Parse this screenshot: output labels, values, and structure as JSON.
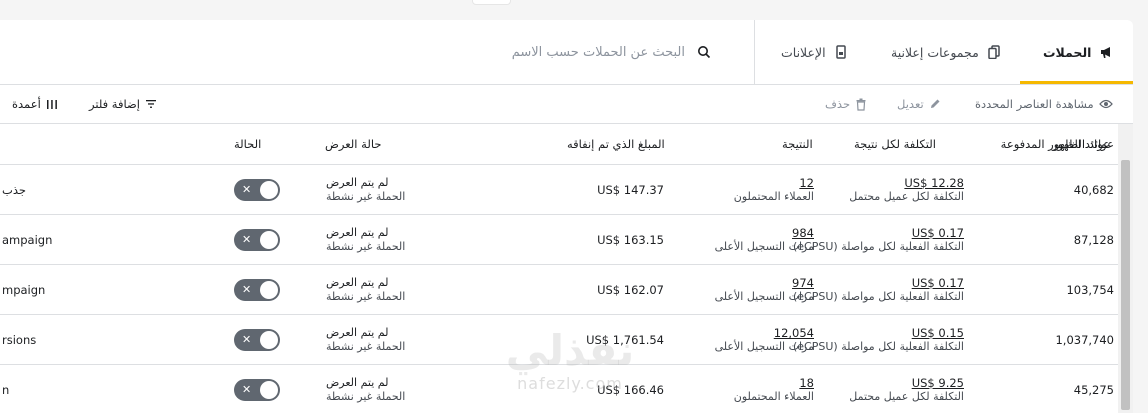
{
  "tabs": [
    {
      "label": "الحملات",
      "icon": "megaphone-icon",
      "active": true
    },
    {
      "label": "مجموعات إعلانية",
      "icon": "ad-sets-icon",
      "active": false
    },
    {
      "label": "الإعلانات",
      "icon": "ad-icon",
      "active": false
    }
  ],
  "search": {
    "placeholder": "البحث عن الحملات حسب الاسم"
  },
  "toolbar": {
    "view_selected": "مشاهدة العناصر المحددة",
    "edit": "تعديل",
    "delete": "حذف",
    "add_filter": "إضافة فلتر",
    "columns": "أعمدة"
  },
  "columns": {
    "name": "عوائد الظهور",
    "paid_reach": "عوائد الظهور المدفوعة",
    "cost_per_result": "التكلفة لكل نتيجة",
    "result": "النتيجة",
    "amount_spent": "المبلغ الذي تم إنفاقه",
    "delivery": "حالة العرض",
    "status": "الحالة"
  },
  "rows": [
    {
      "name": "جذب",
      "reach": "40,682",
      "cost": "US$ 12.28",
      "cost_label": "التكلفة لكل عميل محتمل",
      "result": "12",
      "result_label": "العملاء المحتملون",
      "spent": "US$ 147.37",
      "delivery": "لم يتم العرض",
      "delivery_sub": "الحملة غير نشطة"
    },
    {
      "name": "ampaign",
      "reach": "87,128",
      "cost": "US$ 0.17",
      "cost_label": "(eCPSU) التكلفة الفعلية لكل مواصلة",
      "result": "984",
      "result_label": "مرات التسجيل الأعلى",
      "spent": "US$ 163.15",
      "delivery": "لم يتم العرض",
      "delivery_sub": "الحملة غير نشطة"
    },
    {
      "name": "mpaign",
      "reach": "103,754",
      "cost": "US$ 0.17",
      "cost_label": "(eCPSU) التكلفة الفعلية لكل مواصلة",
      "result": "974",
      "result_label": "مرات التسجيل الأعلى",
      "spent": "US$ 162.07",
      "delivery": "لم يتم العرض",
      "delivery_sub": "الحملة غير نشطة"
    },
    {
      "name": "rsions",
      "reach": "1,037,740",
      "cost": "US$ 0.15",
      "cost_label": "(eCPSU) التكلفة الفعلية لكل مواصلة",
      "result": "12,054",
      "result_label": "مرات التسجيل الأعلى",
      "spent": "US$ 1,761.54",
      "delivery": "لم يتم العرض",
      "delivery_sub": "الحملة غير نشطة"
    },
    {
      "name": "n",
      "reach": "45,275",
      "cost": "US$ 9.25",
      "cost_label": "التكلفة لكل عميل محتمل",
      "result": "18",
      "result_label": "العملاء المحتملون",
      "spent": "US$ 166.46",
      "delivery": "لم يتم العرض",
      "delivery_sub": "الحملة غير نشطة"
    }
  ],
  "watermark": {
    "arabic": "نفذلي",
    "latin": "nafezly.com"
  },
  "colors": {
    "accent": "#f5b800",
    "toggle_off": "#606770",
    "border": "#dddfe2"
  }
}
